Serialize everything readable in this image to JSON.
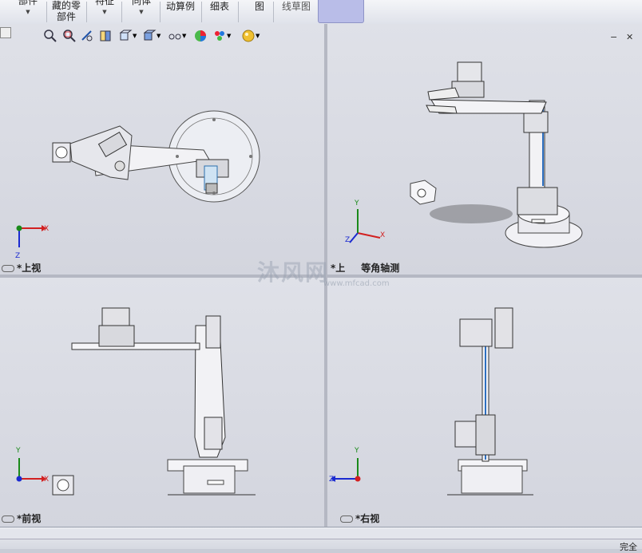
{
  "toolbar": {
    "items": [
      {
        "line1": "部件",
        "line2": "",
        "arrow": true
      },
      {
        "line1": "藏的零",
        "line2": "部件",
        "arrow": false
      },
      {
        "line1": "特征",
        "line2": "",
        "arrow": true
      },
      {
        "line1": "同体",
        "line2": "",
        "arrow": true
      },
      {
        "line1": "动算例",
        "line2": "",
        "arrow": false
      },
      {
        "line1": "细表",
        "line2": "",
        "arrow": false
      },
      {
        "line1": "图",
        "line2": "",
        "arrow": false
      },
      {
        "line1": "线草图",
        "line2": "",
        "arrow": false
      }
    ]
  },
  "viewports": {
    "top": {
      "label": "*上视"
    },
    "iso": {
      "label_prefix": "*上",
      "label_suffix": "等角轴测"
    },
    "front": {
      "label": "*前视"
    },
    "right": {
      "label": "*右视"
    }
  },
  "triad_axes": {
    "x": "X",
    "y": "Y",
    "z": "Z"
  },
  "watermark": {
    "text": "沐风网",
    "sub": "www.mfcad.com"
  },
  "status": {
    "text": "完全"
  },
  "colors": {
    "x_axis": "#d22020",
    "y_axis": "#1a8a1a",
    "z_axis": "#1a2ad0"
  },
  "icons": [
    "zoom-to-fit-icon",
    "zoom-area-icon",
    "previous-view-icon",
    "section-view-icon",
    "view-orientation-icon",
    "display-style-icon",
    "hide-show-icon",
    "edit-appearance-icon",
    "apply-scene-icon",
    "view-settings-icon"
  ]
}
